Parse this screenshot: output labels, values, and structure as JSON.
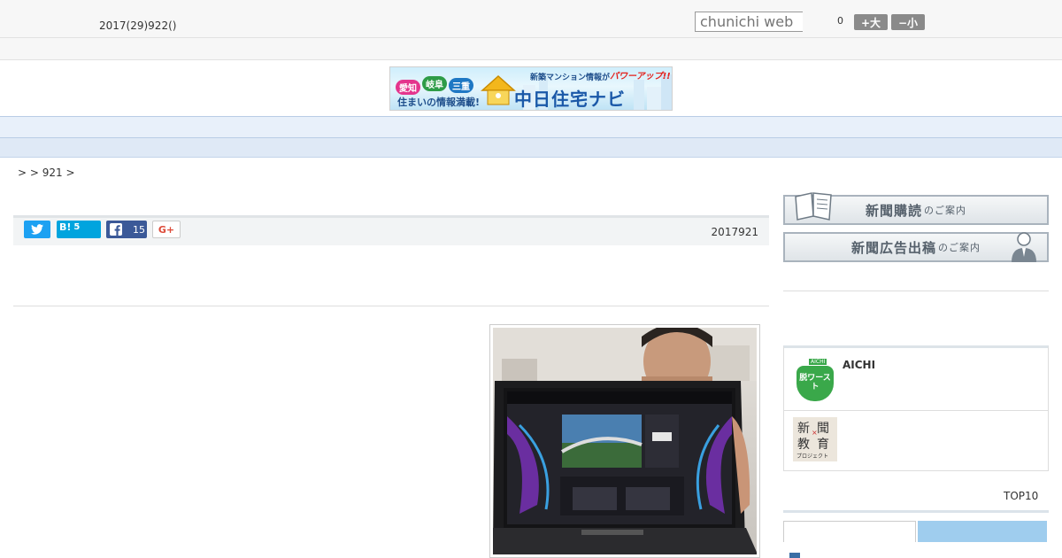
{
  "header": {
    "date": "2017(29)922()",
    "search_placeholder": "chunichi web",
    "fontsize_count": "0",
    "fontsize_increase": "+大",
    "fontsize_decrease": "−小"
  },
  "banner": {
    "prefectures": [
      "愛知",
      "岐阜",
      "三重"
    ],
    "tagline": "住まいの情報満載!",
    "headline": "新築マンション情報が",
    "headline_accent": "パワーアップ!!",
    "logo": "中日住宅ナビ"
  },
  "nav": {
    "items": [
      "",
      "",
      "",
      "",
      "",
      "",
      "",
      "",
      ""
    ]
  },
  "breadcrumb": ">  > 921 >",
  "share": {
    "hatena_label": "B!",
    "hatena_count": "5",
    "facebook_count": "15",
    "gplus_label": "G+",
    "pub_date": "2017921"
  },
  "sidebar": {
    "subscribe_main": "新聞購読",
    "subscribe_suffix": "のご案内",
    "advertise_main": "新聞広告出稿",
    "advertise_suffix": "のご案内",
    "aichi_badge_top": "AICHI",
    "aichi_badge_main": "脱ワースト",
    "aichi_title": "AICHI",
    "education_logo": [
      "新",
      "聞",
      "教",
      "育"
    ],
    "education_sub": "プロジェクト",
    "top10_label": "TOP10"
  },
  "colors": {
    "twitter": "#1da1f2",
    "hatena": "#00a4de",
    "facebook": "#3b5998",
    "nav_bg": "#e8f0fa",
    "tab_active": "#9fcdee",
    "aichi_green": "#3aa84a"
  },
  "icons": [
    "twitter-icon",
    "hatena-icon",
    "facebook-icon",
    "google-plus-icon",
    "book-icon",
    "person-icon"
  ]
}
